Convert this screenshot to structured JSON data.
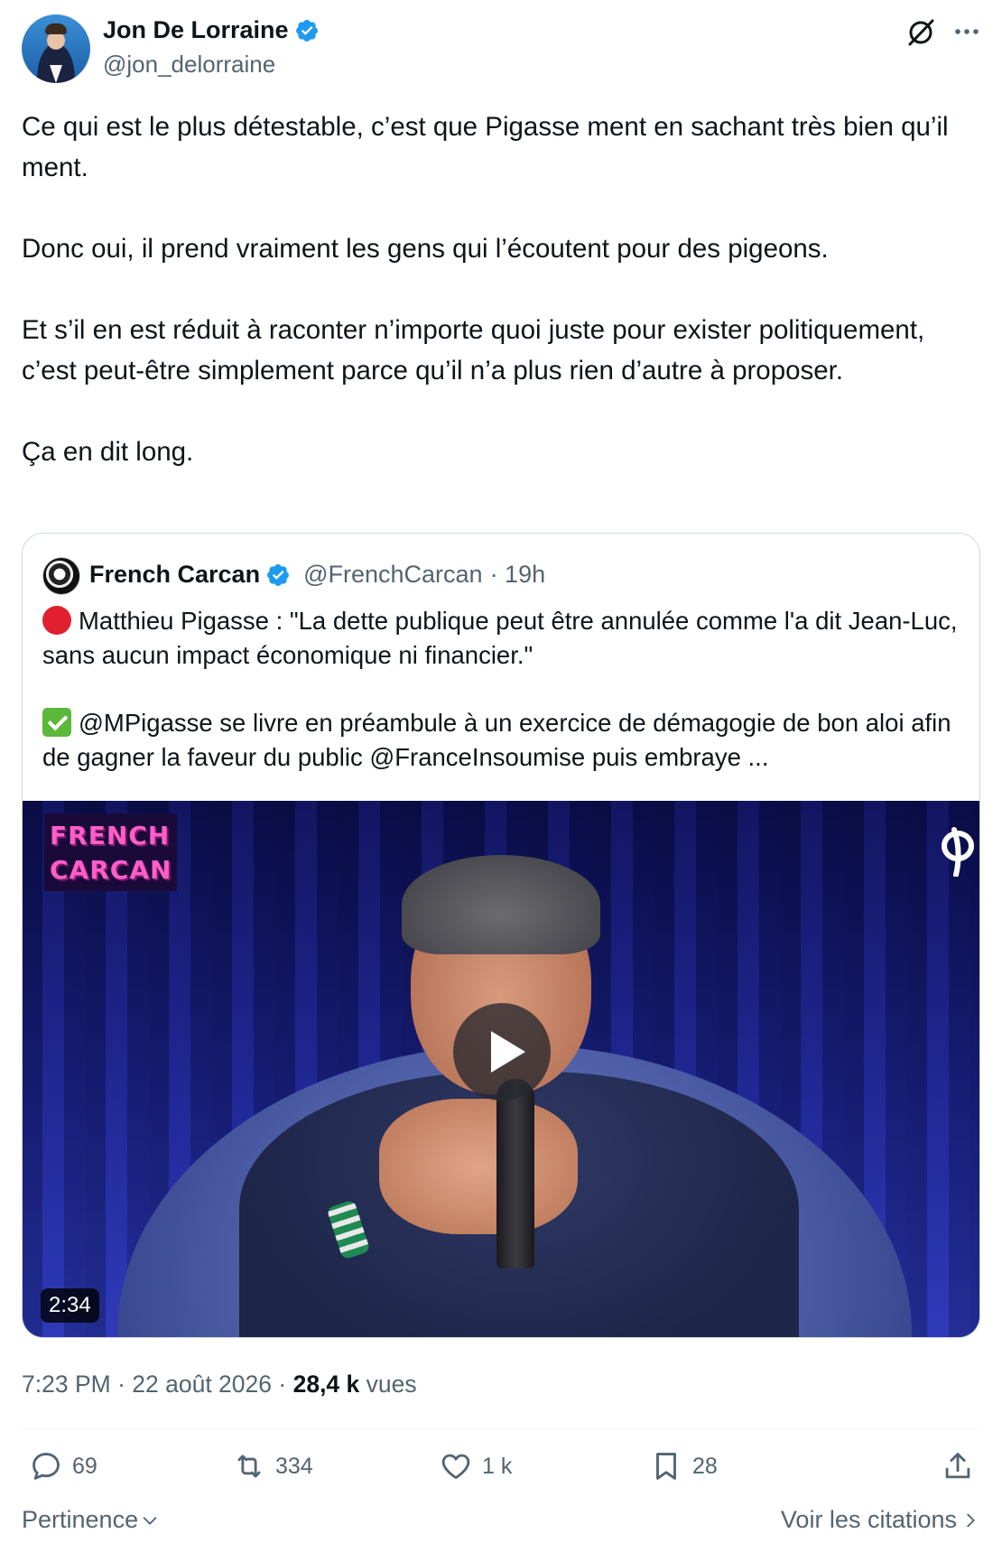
{
  "author": {
    "display_name": "Jon De Lorraine",
    "handle": "@jon_delorraine",
    "verified": true
  },
  "tweet": {
    "paragraphs": [
      "Ce qui est le plus détestable, c’est que Pigasse ment en sachant très bien qu’il ment.",
      "Donc oui, il prend vraiment les gens qui l’écoutent pour des pigeons.",
      "Et s’il en est réduit à raconter n’importe quoi juste pour exister politiquement, c’est peut-être simplement parce qu’il n’a plus rien d’autre à proposer.",
      "Ça en dit long."
    ]
  },
  "quote": {
    "display_name": "French Carcan",
    "handle": "@FrenchCarcan",
    "time": "· 19h",
    "paragraph_1": "Matthieu Pigasse : \"La dette publique peut être annulée comme l'a dit Jean-Luc, sans aucun impact économique ni financier.\"",
    "paragraph_2": "@MPigasse se livre en préambule à un exercice de démagogie de bon aloi afin de gagner la faveur du public @FranceInsoumise puis embraye ...",
    "video": {
      "brand_line_1": "FRENCH",
      "brand_line_2": "CARCAN",
      "duration": "2:34"
    }
  },
  "meta": {
    "time": "7:23 PM",
    "separator": "·",
    "date": "22 août 2026",
    "views_count": "28,4 k",
    "views_label": "vues"
  },
  "actions": {
    "replies": "69",
    "reposts": "334",
    "likes": "1 k",
    "bookmarks": "28"
  },
  "footer": {
    "sort_label": "Pertinence",
    "quotes_link": "Voir les citations"
  },
  "colors": {
    "verified_blue": "#1d9bf0",
    "secondary_text": "#536471",
    "primary_text": "#0f1419",
    "border": "#cfd9de"
  },
  "icons": [
    "verified-badge-icon",
    "grok-icon",
    "more-icon",
    "reply-icon",
    "repost-icon",
    "like-icon",
    "bookmark-icon",
    "share-icon",
    "chevron-down-icon",
    "chevron-right-icon",
    "play-icon"
  ]
}
